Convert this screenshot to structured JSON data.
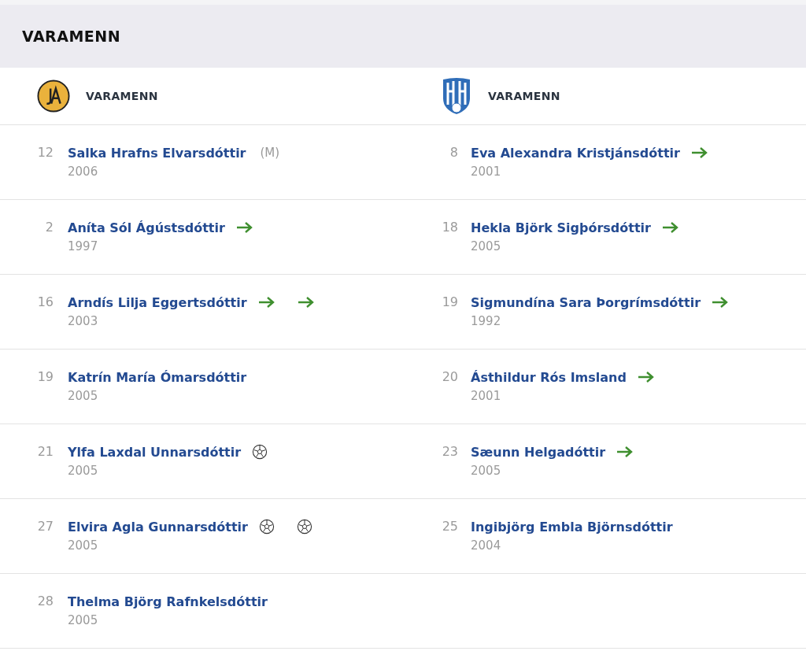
{
  "section_title": "VARAMENN",
  "teams": [
    {
      "label": "VARAMENN",
      "players": [
        {
          "number": "12",
          "name": "Salka Hrafns Elvarsdóttir",
          "note": "(M)",
          "year": "2006"
        },
        {
          "number": "2",
          "name": "Aníta Sól Ágústsdóttir",
          "year": "1997",
          "events": [
            {
              "kind": "sub"
            }
          ]
        },
        {
          "number": "16",
          "name": "Arndís Lilja Eggertsdóttir",
          "year": "2003",
          "events": [
            {
              "kind": "sub"
            },
            {
              "kind": "sub"
            }
          ]
        },
        {
          "number": "19",
          "name": "Katrín María Ómarsdóttir",
          "year": "2005"
        },
        {
          "number": "21",
          "name": "Ylfa Laxdal Unnarsdóttir",
          "year": "2005",
          "events": [
            {
              "kind": "goal"
            }
          ]
        },
        {
          "number": "27",
          "name": "Elvira Agla Gunnarsdóttir",
          "year": "2005",
          "events": [
            {
              "kind": "goal"
            },
            {
              "kind": "goal"
            }
          ]
        },
        {
          "number": "28",
          "name": "Thelma Björg Rafnkelsdóttir",
          "year": "2005"
        }
      ]
    },
    {
      "label": "VARAMENN",
      "players": [
        {
          "number": "8",
          "name": "Eva Alexandra Kristjánsdóttir",
          "year": "2001",
          "events": [
            {
              "kind": "sub"
            }
          ]
        },
        {
          "number": "18",
          "name": "Hekla Björk Sigþórsdóttir",
          "year": "2005",
          "events": [
            {
              "kind": "sub"
            }
          ]
        },
        {
          "number": "19",
          "name": "Sigmundína Sara Þorgrímsdóttir",
          "year": "1992",
          "events": [
            {
              "kind": "sub"
            }
          ]
        },
        {
          "number": "20",
          "name": "Ásthildur Rós Imsland",
          "year": "2001",
          "events": [
            {
              "kind": "sub"
            }
          ]
        },
        {
          "number": "23",
          "name": "Sæunn Helgadóttir",
          "year": "2005",
          "events": [
            {
              "kind": "sub"
            }
          ]
        },
        {
          "number": "25",
          "name": "Ingibjörg Embla Björnsdóttir",
          "year": "2004"
        }
      ]
    }
  ]
}
